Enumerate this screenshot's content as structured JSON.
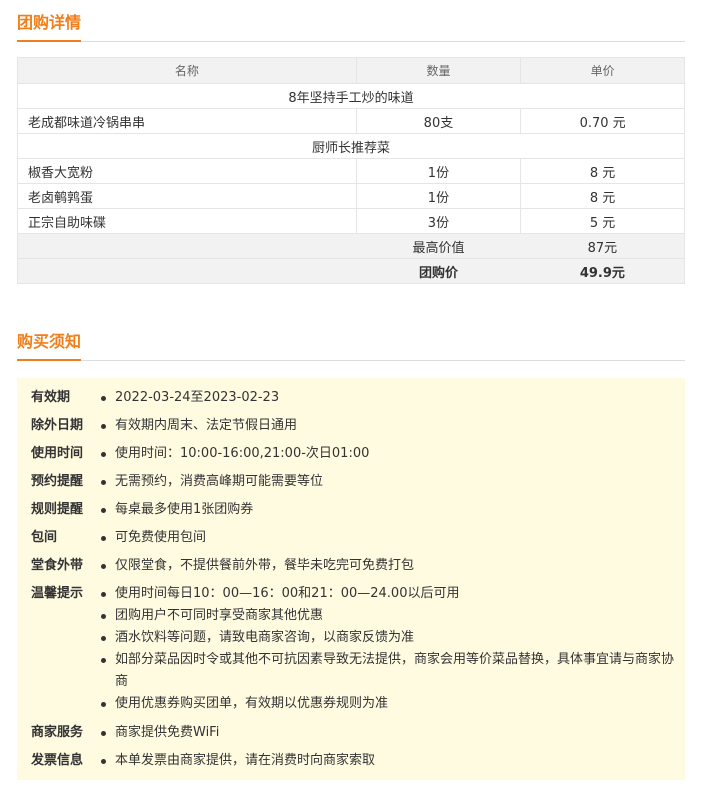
{
  "section1": {
    "title": "团购详情"
  },
  "table": {
    "headers": [
      "名称",
      "数量",
      "单价"
    ],
    "groups": [
      {
        "title": "8年坚持手工炒的味道",
        "items": [
          {
            "name": "老成都味道冷锅串串",
            "qty": "80支",
            "price": "0.70 元"
          }
        ]
      },
      {
        "title": "厨师长推荐菜",
        "items": [
          {
            "name": "椒香大宽粉",
            "qty": "1份",
            "price": "8 元"
          },
          {
            "name": "老卤鹌鹑蛋",
            "qty": "1份",
            "price": "8 元"
          },
          {
            "name": "正宗自助味碟",
            "qty": "3份",
            "price": "5 元"
          }
        ]
      }
    ],
    "summary": {
      "max_value_label": "最高价值",
      "max_value": "87元",
      "group_price_label": "团购价",
      "group_price": "49.9元"
    }
  },
  "section2": {
    "title": "购买须知"
  },
  "notice": [
    {
      "label": "有效期",
      "items": [
        "2022-03-24至2023-02-23"
      ]
    },
    {
      "label": "除外日期",
      "items": [
        "有效期内周末、法定节假日通用"
      ]
    },
    {
      "label": "使用时间",
      "items": [
        "使用时间：10:00-16:00,21:00-次日01:00"
      ]
    },
    {
      "label": "预约提醒",
      "items": [
        "无需预约，消费高峰期可能需要等位"
      ]
    },
    {
      "label": "规则提醒",
      "items": [
        "每桌最多使用1张团购券"
      ]
    },
    {
      "label": "包间",
      "items": [
        "可免费使用包间"
      ]
    },
    {
      "label": "堂食外带",
      "items": [
        "仅限堂食，不提供餐前外带，餐毕未吃完可免费打包"
      ]
    },
    {
      "label": "温馨提示",
      "items": [
        "使用时间每日10：00—16：00和21：00—24.00以后可用",
        "团购用户不可同时享受商家其他优惠",
        "酒水饮料等问题，请致电商家咨询，以商家反馈为准",
        "如部分菜品因时令或其他不可抗因素导致无法提供，商家会用等价菜品替换，具体事宜请与商家协商",
        "使用优惠券购买团单，有效期以优惠券规则为准"
      ]
    },
    {
      "label": "商家服务",
      "items": [
        "商家提供免费WiFi"
      ]
    },
    {
      "label": "发票信息",
      "items": [
        "本单发票由商家提供，请在消费时向商家索取"
      ]
    }
  ]
}
